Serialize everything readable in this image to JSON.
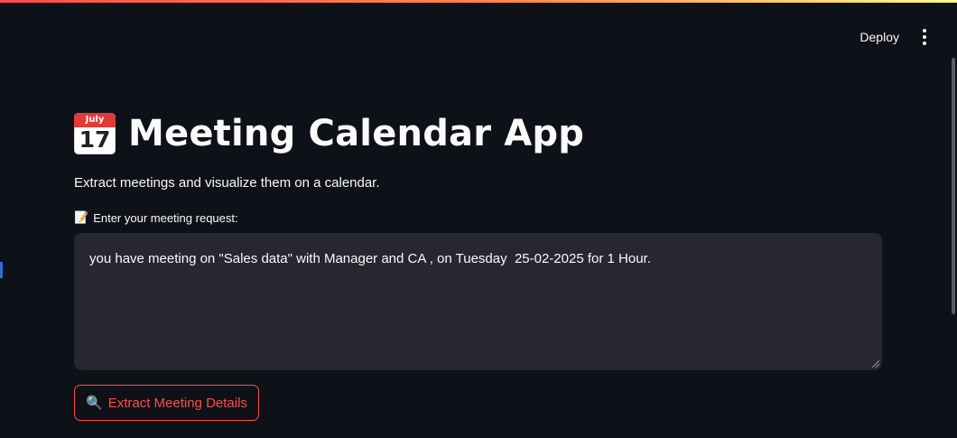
{
  "header": {
    "deploy_label": "Deploy"
  },
  "main": {
    "title_icon": {
      "month": "July",
      "day": "17"
    },
    "title": "Meeting Calendar App",
    "subtitle": "Extract meetings and visualize them on a calendar.",
    "input_label": "Enter your meeting request:",
    "input_label_icon": "📝",
    "meeting_request_value": "you have meeting on \"Sales data\" with Manager and CA , on Tuesday  25-02-2025 for 1 Hour.",
    "extract_button_icon": "🔍",
    "extract_button_label": "Extract Meeting Details"
  },
  "colors": {
    "background": "#0e1117",
    "input_background": "#262730",
    "accent": "#ff4b4b",
    "text": "#fafafa"
  },
  "icons": {
    "title": "calendar-icon",
    "label": "memo-icon",
    "button": "search-icon",
    "menu": "kebab-menu-icon"
  }
}
